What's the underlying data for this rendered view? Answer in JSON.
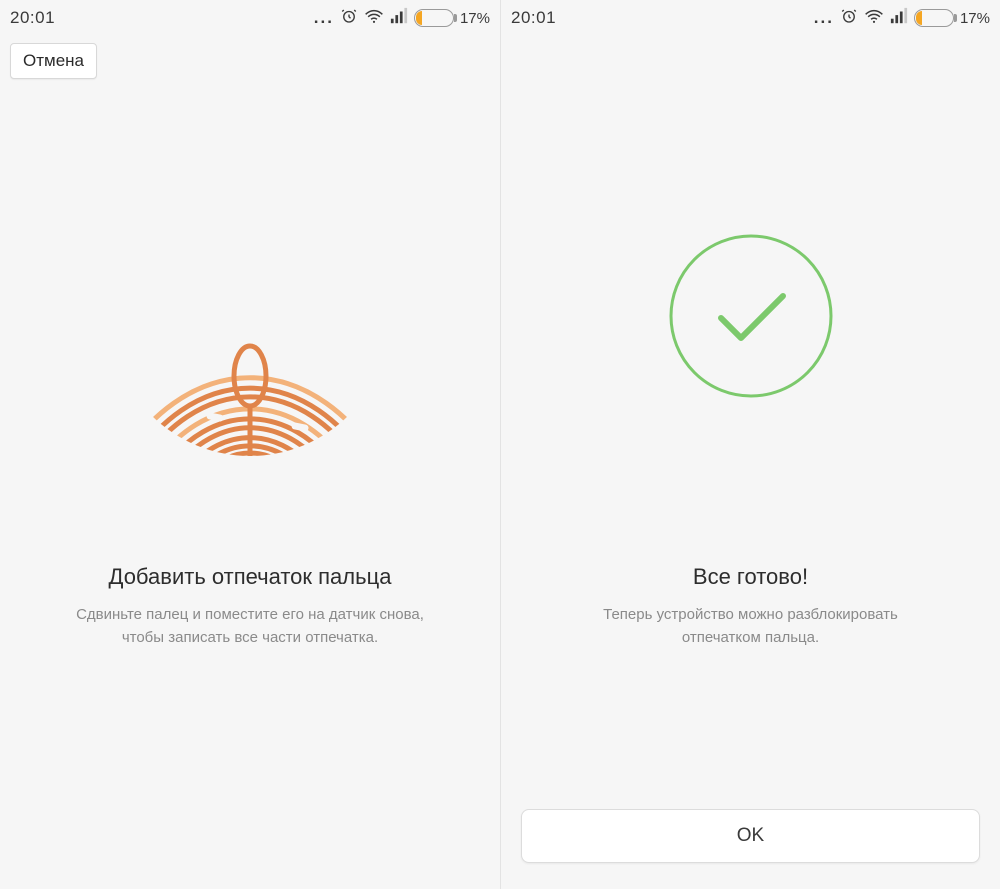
{
  "status": {
    "time": "20:01",
    "dots": "...",
    "battery_pct": "17%"
  },
  "screen1": {
    "toolbar": {
      "cancel_label": "Отмена"
    },
    "title": "Добавить отпечаток пальца",
    "subtitle_line1": "Сдвиньте палец и поместите его на датчик снова,",
    "subtitle_line2": "чтобы записать все части отпечатка."
  },
  "screen2": {
    "title": "Все готово!",
    "subtitle_line1": "Теперь устройство можно разблокировать",
    "subtitle_line2": "отпечатком пальца.",
    "ok_label": "OK"
  },
  "colors": {
    "accent": "#f5a623",
    "success": "#6fbf5b"
  }
}
